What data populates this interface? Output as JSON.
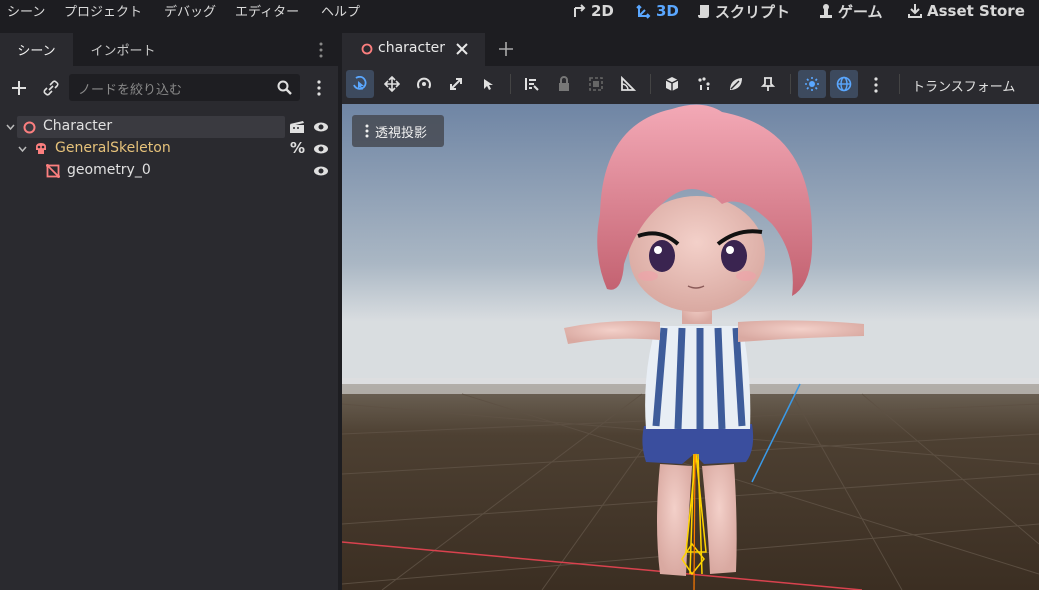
{
  "menu": [
    "シーン",
    "プロジェクト",
    "デバッグ",
    "エディター",
    "ヘルプ"
  ],
  "workspaces": {
    "btn_2d": "2D",
    "btn_3d": "3D",
    "btn_script": "スクリプト",
    "btn_game": "ゲーム",
    "btn_asset": "Asset Store",
    "active": "3D",
    "accent_color": "#5aa7ff"
  },
  "left_panel": {
    "tabs": [
      "シーン",
      "インポート"
    ],
    "active_tab": "シーン",
    "filter_placeholder": "ノードを絞り込む",
    "tree": [
      {
        "label": "Character",
        "icon": "node3d-icon",
        "color": "#e0e0e0",
        "selected": true
      },
      {
        "label": "GeneralSkeleton",
        "icon": "skeleton-icon",
        "color": "#e6c27a"
      },
      {
        "label": "geometry_0",
        "icon": "mesh-icon",
        "color": "#e0e0e0"
      }
    ]
  },
  "editor": {
    "tab_label": "character",
    "transform_label": "トランスフォーム",
    "perspective_label": "透視投影"
  }
}
